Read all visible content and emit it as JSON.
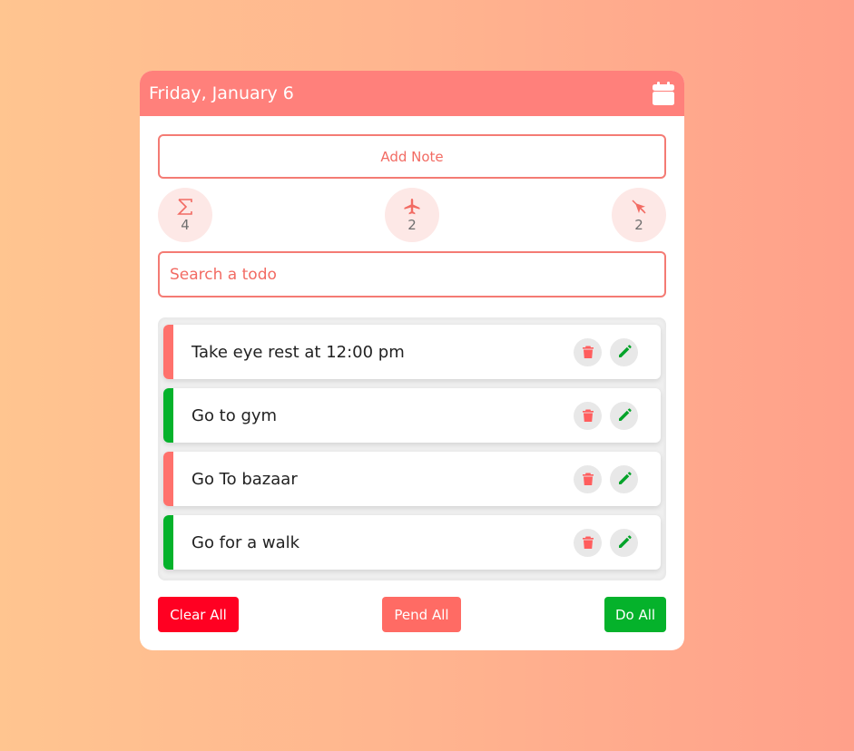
{
  "header": {
    "date_title": "Friday, January 6",
    "calendar_icon": "calendar-icon"
  },
  "add_note": {
    "label": "Add Note"
  },
  "stats": {
    "total": {
      "icon": "sigma-icon",
      "count": "4"
    },
    "pending": {
      "icon": "plane-icon",
      "count": "2"
    },
    "done": {
      "icon": "plane-off-icon",
      "count": "2"
    }
  },
  "search": {
    "placeholder": "Search a todo",
    "value": ""
  },
  "todos": [
    {
      "text": "Take eye rest at 12:00 pm",
      "status": "pending",
      "status_color": "#ff716c"
    },
    {
      "text": "Go to gym",
      "status": "done",
      "status_color": "#05b22b"
    },
    {
      "text": "Go To bazaar",
      "status": "pending",
      "status_color": "#ff716c"
    },
    {
      "text": "Go for a walk",
      "status": "done",
      "status_color": "#05b22b"
    }
  ],
  "footer": {
    "clear_all": "Clear All",
    "pend_all": "Pend All",
    "do_all": "Do All"
  },
  "colors": {
    "accent": "#ff807b",
    "danger": "#ff0022",
    "pending": "#ff6b64",
    "success": "#05b22b",
    "delete_icon": "#ff5e5e",
    "edit_icon": "#05a32a"
  }
}
